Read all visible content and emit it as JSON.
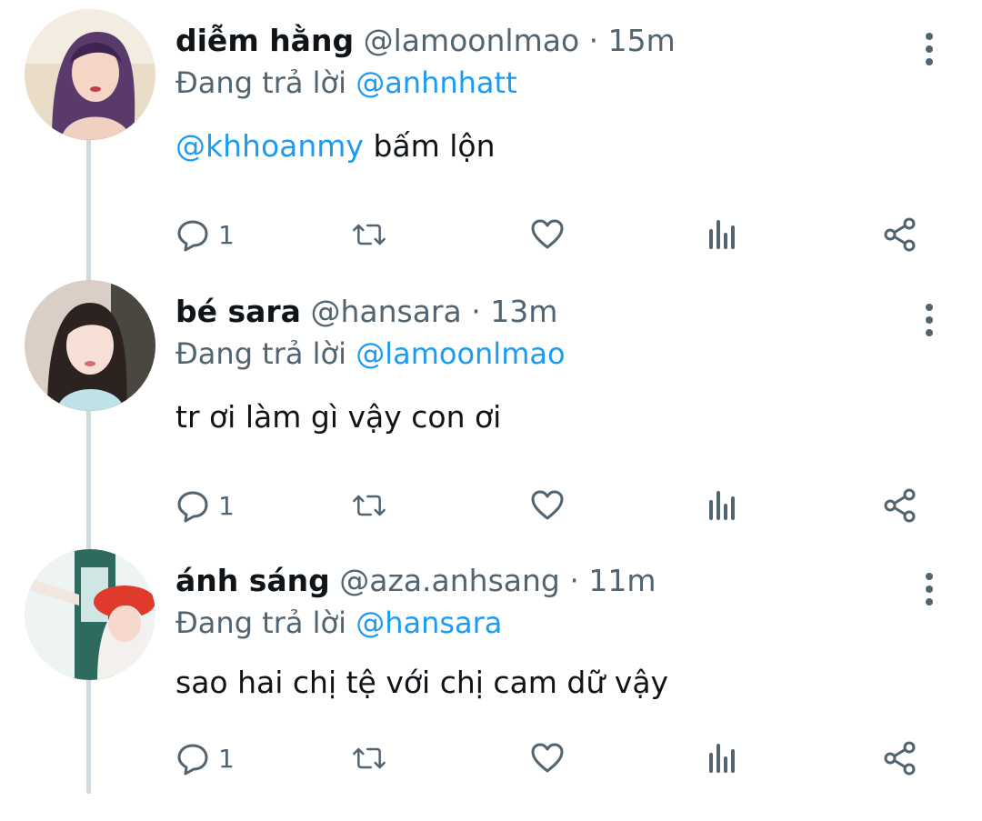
{
  "tweets": [
    {
      "name": "diễm hằng",
      "handle": "@lamoonlmao",
      "dot": "·",
      "time": "15m",
      "reply_prefix": "Đang trả lời",
      "reply_to": "@anhnhatt",
      "mention": "@khhoanmy",
      "text": "bấm lộn",
      "reply_count": "1"
    },
    {
      "name": "bé sara",
      "handle": "@hansara",
      "dot": "·",
      "time": "13m",
      "reply_prefix": "Đang trả lời",
      "reply_to": "@lamoonlmao",
      "mention": "",
      "text": "tr ơi làm gì vậy con ơi",
      "reply_count": "1"
    },
    {
      "name": "ánh sáng",
      "handle": "@aza.anhsang",
      "dot": "·",
      "time": "11m",
      "reply_prefix": "Đang trả lời",
      "reply_to": "@hansara",
      "mention": "",
      "text": "sao hai chị tệ với chị cam dữ vậy",
      "reply_count": "1"
    }
  ],
  "colors": {
    "accent": "#1d9bf0",
    "secondary_text": "#536471",
    "thread_line": "#cfd9de"
  },
  "icons": [
    "reply-icon",
    "retweet-icon",
    "like-icon",
    "views-icon",
    "share-icon",
    "more-icon"
  ]
}
